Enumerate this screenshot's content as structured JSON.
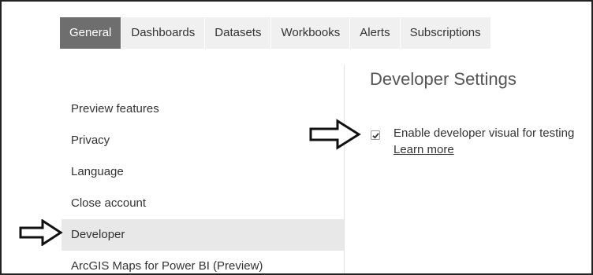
{
  "tabs": [
    {
      "label": "General",
      "active": true
    },
    {
      "label": "Dashboards",
      "active": false
    },
    {
      "label": "Datasets",
      "active": false
    },
    {
      "label": "Workbooks",
      "active": false
    },
    {
      "label": "Alerts",
      "active": false
    },
    {
      "label": "Subscriptions",
      "active": false
    }
  ],
  "sidebar": {
    "items": [
      {
        "label": "Preview features"
      },
      {
        "label": "Privacy"
      },
      {
        "label": "Language"
      },
      {
        "label": "Close account"
      },
      {
        "label": "Developer",
        "selected": true
      },
      {
        "label": "ArcGIS Maps for Power BI (Preview)"
      }
    ]
  },
  "main": {
    "title": "Developer Settings",
    "checkbox": {
      "label": "Enable developer visual for testing",
      "checked": true
    },
    "link": "Learn more"
  },
  "annotations": {
    "arrow_icon": "right-outline-arrow-icon"
  },
  "colors": {
    "tab_active_bg": "#6e6e6e",
    "tab_bg": "#f0f0f0",
    "selected_bg": "#e8e8e8"
  }
}
